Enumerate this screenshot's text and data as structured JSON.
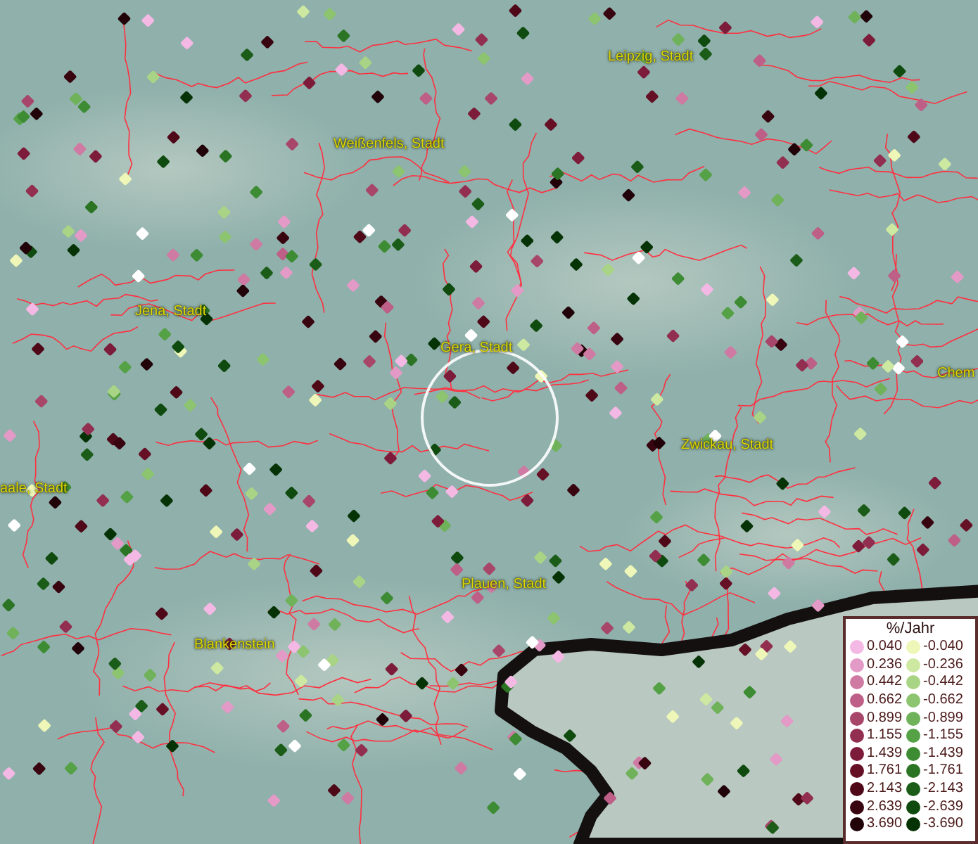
{
  "map": {
    "places": [
      {
        "name": "Leipzig, Stadt"
      },
      {
        "name": "Weißenfels, Stadt"
      },
      {
        "name": "Jena, Stadt"
      },
      {
        "name": "Gera, Stadt"
      },
      {
        "name": "Chem"
      },
      {
        "name": "Zwickau, Stadt"
      },
      {
        "name": "aale, Stadt"
      },
      {
        "name": "Plauen, Stadt"
      },
      {
        "name": "Blankenstein"
      }
    ]
  },
  "legend": {
    "title": "%/Jahr",
    "positive": [
      {
        "value": "0.040",
        "color": "#f4b8e4"
      },
      {
        "value": "0.236",
        "color": "#e39ac6"
      },
      {
        "value": "0.442",
        "color": "#cf7aa3"
      },
      {
        "value": "0.662",
        "color": "#bd5f86"
      },
      {
        "value": "0.899",
        "color": "#a8466a"
      },
      {
        "value": "1.155",
        "color": "#922f50"
      },
      {
        "value": "1.439",
        "color": "#7d1c3a"
      },
      {
        "value": "1.761",
        "color": "#661026"
      },
      {
        "value": "2.143",
        "color": "#4f0818"
      },
      {
        "value": "2.639",
        "color": "#38040f"
      },
      {
        "value": "3.690",
        "color": "#200208"
      }
    ],
    "negative": [
      {
        "value": "-0.040",
        "color": "#eef7b8"
      },
      {
        "value": "-0.236",
        "color": "#cde8a0"
      },
      {
        "value": "-0.442",
        "color": "#a9d485"
      },
      {
        "value": "-0.662",
        "color": "#8cc46f"
      },
      {
        "value": "-0.899",
        "color": "#6fb25a"
      },
      {
        "value": "-1.155",
        "color": "#55a145"
      },
      {
        "value": "-1.439",
        "color": "#3d8b33"
      },
      {
        "value": "-1.761",
        "color": "#2a7424"
      },
      {
        "value": "-2.143",
        "color": "#1b5d18"
      },
      {
        "value": "-2.639",
        "color": "#0f4a0e"
      },
      {
        "value": "-3.690",
        "color": "#063306"
      }
    ]
  }
}
